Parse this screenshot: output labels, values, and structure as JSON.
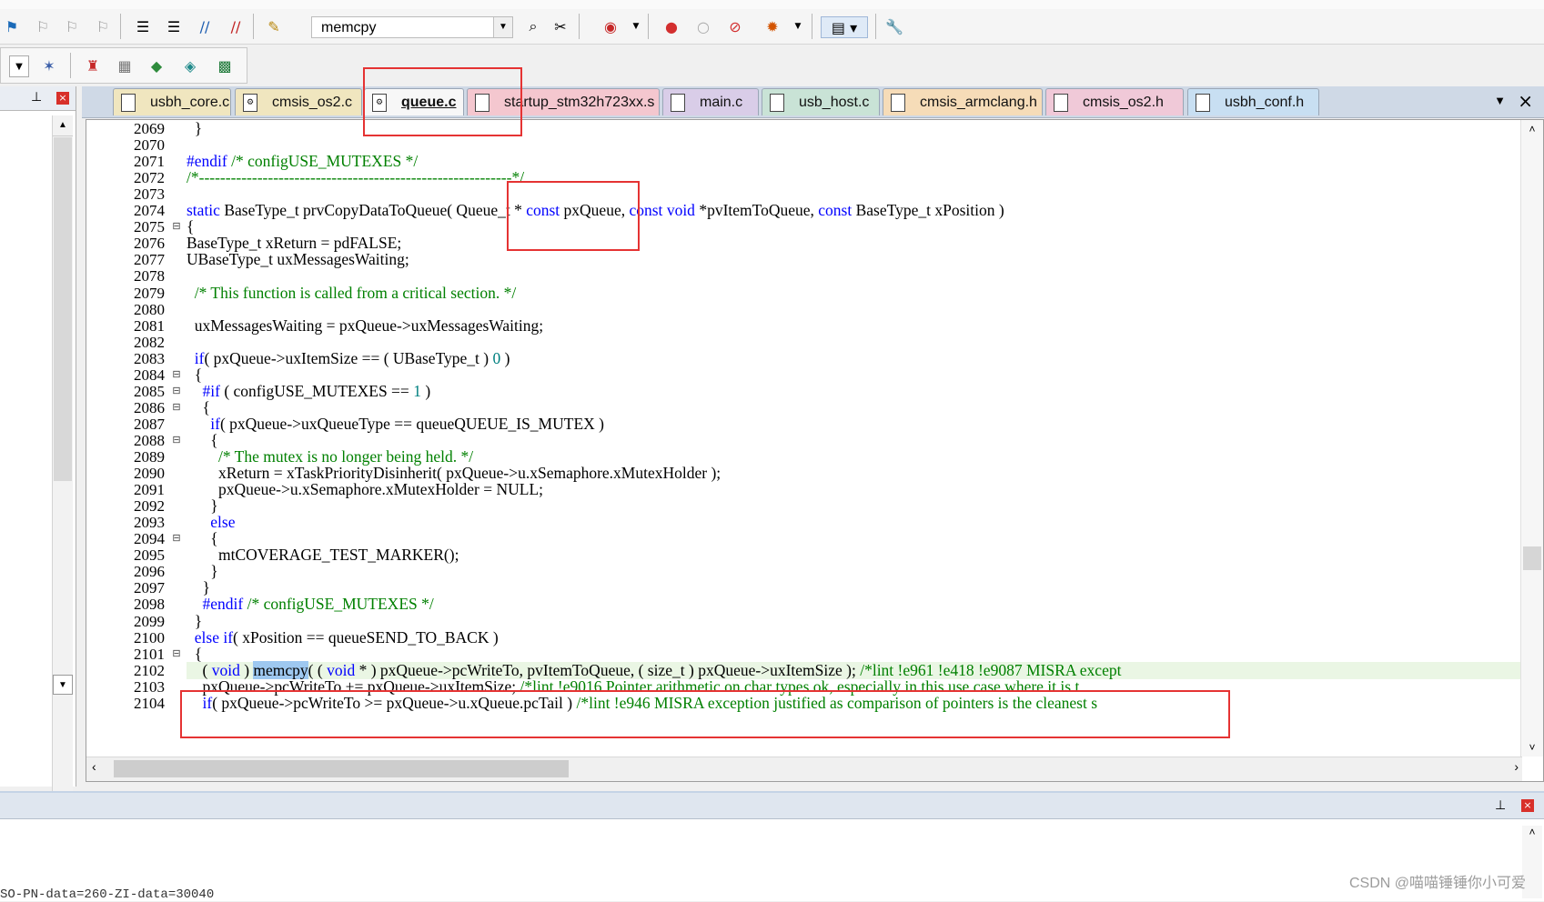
{
  "toolbar": {
    "find_value": "memcpy"
  },
  "tabs": [
    {
      "label": "usbh_core.c",
      "color": "#f0e6bf",
      "icon": "file-icon"
    },
    {
      "label": "cmsis_os2.c",
      "color": "#f0e6bf",
      "icon": "c-file-icon"
    },
    {
      "label": "queue.c",
      "color": "#f7f7f7",
      "icon": "c-file-icon",
      "active": true
    },
    {
      "label": "startup_stm32h723xx.s",
      "color": "#f4c7cf",
      "icon": "file-icon"
    },
    {
      "label": "main.c",
      "color": "#d9cde8",
      "icon": "file-icon"
    },
    {
      "label": "usb_host.c",
      "color": "#c9e3d6",
      "icon": "file-icon"
    },
    {
      "label": "cmsis_armclang.h",
      "color": "#f6dcb8",
      "icon": "file-icon"
    },
    {
      "label": "cmsis_os2.h",
      "color": "#f0c9d8",
      "icon": "file-icon"
    },
    {
      "label": "usbh_conf.h",
      "color": "#c8dff2",
      "icon": "file-icon"
    }
  ],
  "code": {
    "lines": [
      {
        "n": "2069",
        "t": "  }"
      },
      {
        "n": "2070",
        "t": ""
      },
      {
        "n": "2071",
        "t": "#endif /* configUSE_MUTEXES */"
      },
      {
        "n": "2072",
        "t": "/*-----------------------------------------------------------*/"
      },
      {
        "n": "2073",
        "t": ""
      },
      {
        "n": "2074",
        "t": "static BaseType_t prvCopyDataToQueue( Queue_t * const pxQueue, const void *pvItemToQueue, const BaseType_t xPosition )"
      },
      {
        "n": "2075",
        "t": "{"
      },
      {
        "n": "2076",
        "t": "BaseType_t xReturn = pdFALSE;"
      },
      {
        "n": "2077",
        "t": "UBaseType_t uxMessagesWaiting;"
      },
      {
        "n": "2078",
        "t": ""
      },
      {
        "n": "2079",
        "t": "  /* This function is called from a critical section. */"
      },
      {
        "n": "2080",
        "t": ""
      },
      {
        "n": "2081",
        "t": "  uxMessagesWaiting = pxQueue->uxMessagesWaiting;"
      },
      {
        "n": "2082",
        "t": ""
      },
      {
        "n": "2083",
        "t": "  if( pxQueue->uxItemSize == ( UBaseType_t ) 0 )"
      },
      {
        "n": "2084",
        "t": "  {"
      },
      {
        "n": "2085",
        "t": "    #if ( configUSE_MUTEXES == 1 )"
      },
      {
        "n": "2086",
        "t": "    {"
      },
      {
        "n": "2087",
        "t": "      if( pxQueue->uxQueueType == queueQUEUE_IS_MUTEX )"
      },
      {
        "n": "2088",
        "t": "      {"
      },
      {
        "n": "2089",
        "t": "        /* The mutex is no longer being held. */"
      },
      {
        "n": "2090",
        "t": "        xReturn = xTaskPriorityDisinherit( pxQueue->u.xSemaphore.xMutexHolder );"
      },
      {
        "n": "2091",
        "t": "        pxQueue->u.xSemaphore.xMutexHolder = NULL;"
      },
      {
        "n": "2092",
        "t": "      }"
      },
      {
        "n": "2093",
        "t": "      else"
      },
      {
        "n": "2094",
        "t": "      {"
      },
      {
        "n": "2095",
        "t": "        mtCOVERAGE_TEST_MARKER();"
      },
      {
        "n": "2096",
        "t": "      }"
      },
      {
        "n": "2097",
        "t": "    }"
      },
      {
        "n": "2098",
        "t": "    #endif /* configUSE_MUTEXES */"
      },
      {
        "n": "2099",
        "t": "  }"
      },
      {
        "n": "2100",
        "t": "  else if( xPosition == queueSEND_TO_BACK )"
      },
      {
        "n": "2101",
        "t": "  {"
      },
      {
        "n": "2102",
        "t": "    ( void ) memcpy( ( void * ) pxQueue->pcWriteTo, pvItemToQueue, ( size_t ) pxQueue->uxItemSize ); /*lint !e961 !e418 !e9087 MISRA except"
      },
      {
        "n": "2103",
        "t": "    pxQueue->pcWriteTo += pxQueue->uxItemSize; /*lint !e9016 Pointer arithmetic on char types ok, especially in this use case where it is t"
      },
      {
        "n": "2104",
        "t": "    if( pxQueue->pcWriteTo >= pxQueue->u.xQueue.pcTail ) /*lint !e946 MISRA exception justified as comparison of pointers is the cleanest s"
      }
    ]
  },
  "bottom": {
    "output_text": "SO-PN-data=260-ZI-data=30040",
    "watermark": "CSDN @喵喵锤锤你小可爱"
  },
  "colors": {
    "keyword": "#0000ff",
    "comment": "#008000",
    "highlight_box": "#e53333"
  }
}
